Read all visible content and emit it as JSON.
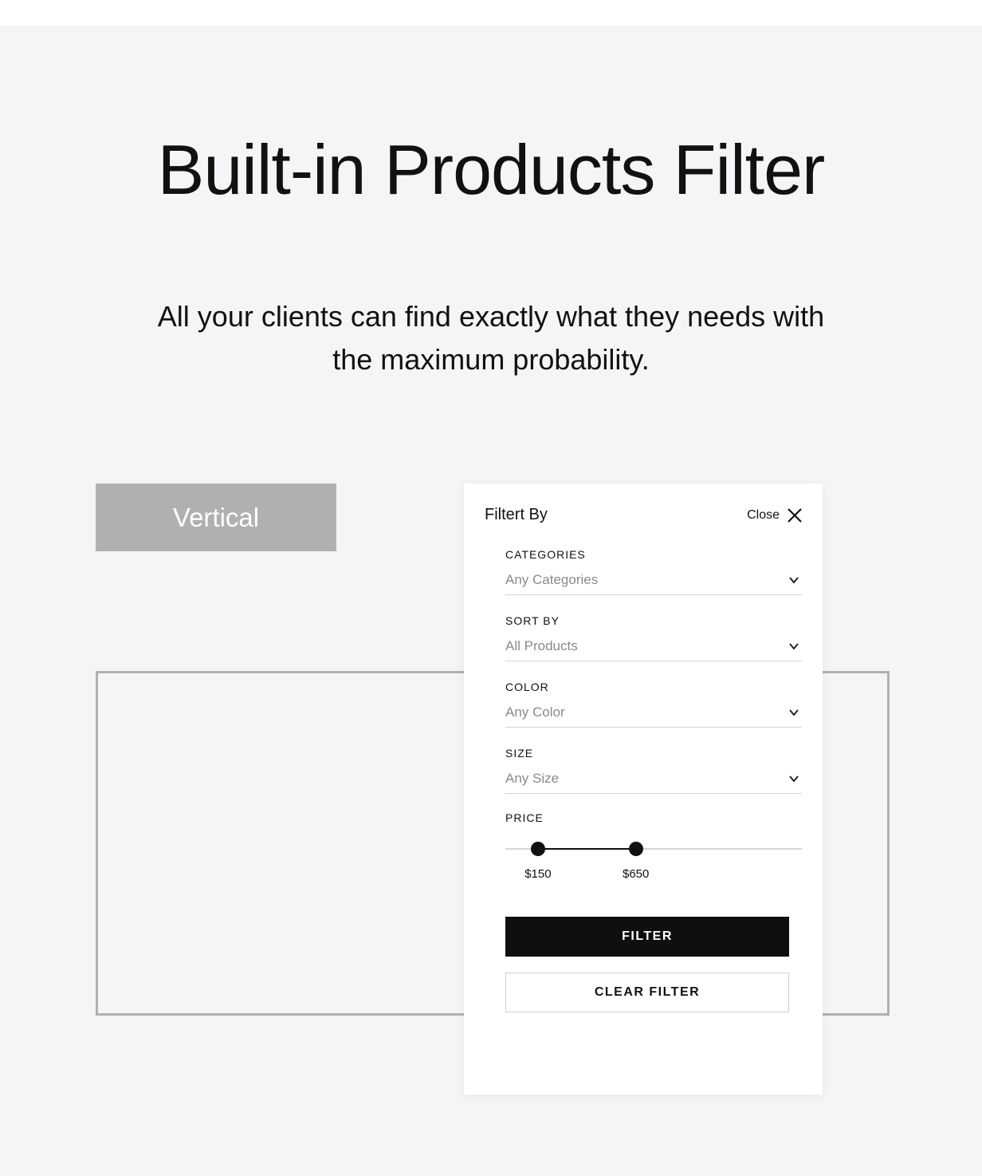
{
  "header": {
    "title": "Built-in Products Filter",
    "subtitle": "All your clients can find exactly what they needs with the maximum probability."
  },
  "tab": {
    "label": "Vertical"
  },
  "filter_panel": {
    "title": "Filtert By",
    "close_label": "Close",
    "fields": {
      "categories": {
        "label": "CATEGORIES",
        "value": "Any Categories"
      },
      "sort_by": {
        "label": "SORT BY",
        "value": "All Products"
      },
      "color": {
        "label": "COLOR",
        "value": "Any Color"
      },
      "size": {
        "label": "SIZE",
        "value": "Any Size"
      }
    },
    "price": {
      "label": "PRICE",
      "min_display": "$150",
      "max_display": "$650",
      "min_value": 150,
      "max_value": 650,
      "range_start_pct": 11,
      "range_end_pct": 44
    },
    "buttons": {
      "filter": "FILTER",
      "clear": "CLEAR FILTER"
    }
  }
}
